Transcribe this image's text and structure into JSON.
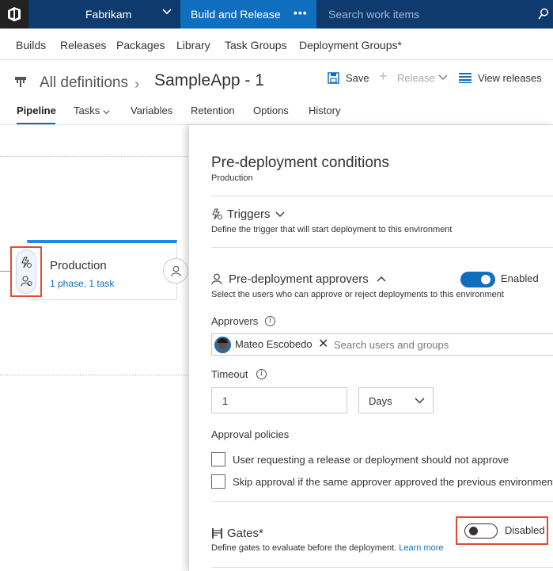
{
  "topbar": {
    "org": "Fabrikam",
    "hub": "Build and Release",
    "more": "•••",
    "search_placeholder": "Search work items"
  },
  "subnav": {
    "items": [
      "Builds",
      "Releases",
      "Packages",
      "Library",
      "Task Groups",
      "Deployment Groups*"
    ]
  },
  "header": {
    "breadcrumb_root": "All definitions",
    "separator": "›",
    "definition_name": "SampleApp - 1",
    "save_label": "Save",
    "release_label": "Release",
    "view_releases_label": "View releases"
  },
  "tabs": {
    "items": [
      "Pipeline",
      "Tasks",
      "Variables",
      "Retention",
      "Options",
      "History"
    ],
    "active": "Pipeline"
  },
  "environment": {
    "name": "Production",
    "summary": "1 phase, 1 task"
  },
  "panel": {
    "title": "Pre-deployment conditions",
    "subtitle": "Production",
    "triggers": {
      "heading": "Triggers",
      "description": "Define the trigger that will start deployment to this environment"
    },
    "approvers_section": {
      "heading": "Pre-deployment approvers",
      "description": "Select the users who can approve or reject deployments to this environment",
      "toggle_label": "Enabled",
      "toggle_on": true,
      "approvers_label": "Approvers",
      "approver_name": "Mateo Escobedo",
      "remove_glyph": "✕",
      "search_placeholder": "Search users and groups",
      "timeout_label": "Timeout",
      "timeout_value": "1",
      "timeout_unit": "Days",
      "policies_label": "Approval policies",
      "policy_1": "User requesting a release or deployment should not approve",
      "policy_2": "Skip approval if the same approver approved the previous environment"
    },
    "gates": {
      "heading": "Gates*",
      "description": "Define gates to evaluate before the deployment.",
      "learn_more": "Learn more",
      "toggle_label": "Disabled",
      "toggle_on": false
    }
  },
  "colors": {
    "topbar": "#0f3a6e",
    "hub_active": "#106ebe",
    "accent": "#106ebe",
    "highlight": "#e04a35"
  }
}
